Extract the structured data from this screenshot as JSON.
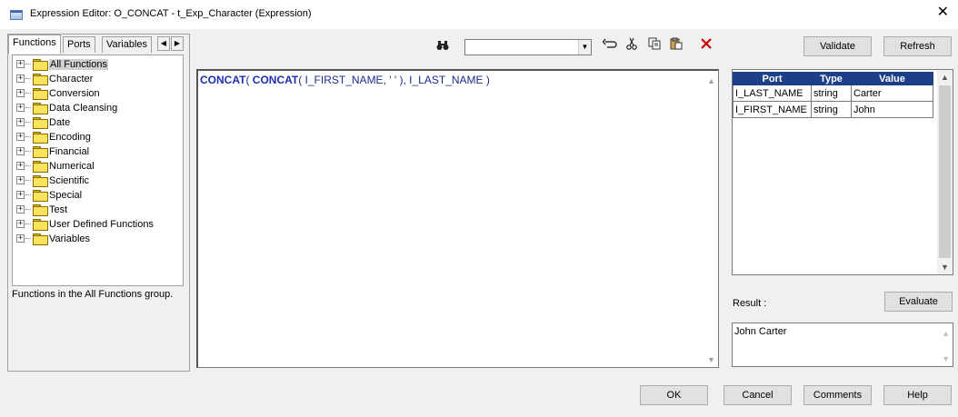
{
  "window": {
    "title": "Expression Editor: O_CONCAT - t_Exp_Character (Expression)",
    "close_glyph": "✕"
  },
  "tabs": [
    {
      "label": "Functions"
    },
    {
      "label": "Ports"
    },
    {
      "label": "Variables"
    }
  ],
  "tab_scroll": {
    "left": "◀",
    "right": "▶"
  },
  "function_tree": [
    {
      "label": "All Functions",
      "selected": true
    },
    {
      "label": "Character"
    },
    {
      "label": "Conversion"
    },
    {
      "label": "Data Cleansing"
    },
    {
      "label": "Date"
    },
    {
      "label": "Encoding"
    },
    {
      "label": "Financial"
    },
    {
      "label": "Numerical"
    },
    {
      "label": "Scientific"
    },
    {
      "label": "Special"
    },
    {
      "label": "Test"
    },
    {
      "label": "User Defined Functions"
    },
    {
      "label": "Variables"
    }
  ],
  "function_description": "Functions in the All Functions group.",
  "toolbar": {
    "find_icon": "binoculars-icon",
    "find_value": "",
    "icons": [
      "undo-icon",
      "cut-icon",
      "copy-icon",
      "paste-icon",
      "delete-icon"
    ]
  },
  "buttons": {
    "validate": "Validate",
    "refresh": "Refresh",
    "evaluate": "Evaluate",
    "ok": "OK",
    "cancel": "Cancel",
    "comments": "Comments",
    "help": "Help"
  },
  "expression": {
    "fn1": "CONCAT",
    "p1": "( ",
    "fn2": "CONCAT",
    "p2": "( I_FIRST_NAME, ' ' ), I_LAST_NAME )"
  },
  "ports_table": {
    "headers": [
      "Port",
      "Type",
      "Value"
    ],
    "rows": [
      [
        "I_LAST_NAME",
        "string",
        "Carter"
      ],
      [
        "I_FIRST_NAME",
        "string",
        "John"
      ]
    ]
  },
  "result": {
    "label": "Result :",
    "value": "John Carter"
  },
  "colors": {
    "keyword": "#1a2fb3",
    "table_header": "#1d3f8a",
    "delete_icon": "#cc0000"
  }
}
